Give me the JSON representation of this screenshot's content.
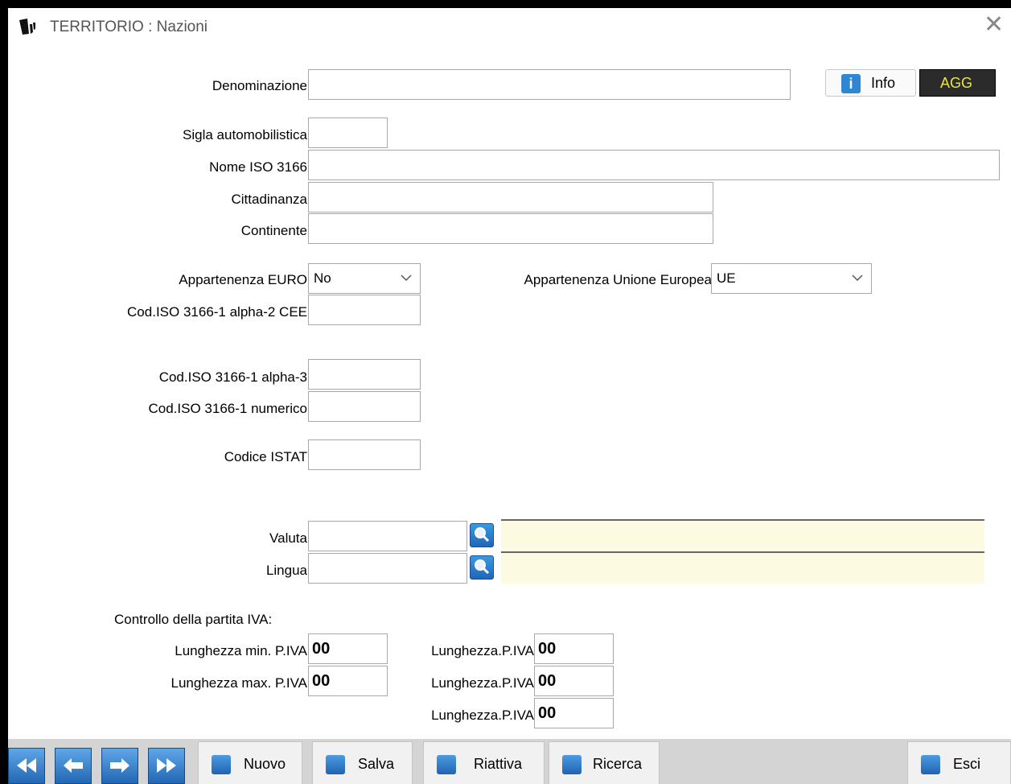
{
  "window": {
    "title": "TERRITORIO : Nazioni"
  },
  "header_buttons": {
    "info_label": "Info",
    "agg_label": "AGG"
  },
  "fields": {
    "denominazione": {
      "label": "Denominazione",
      "value": ""
    },
    "sigla": {
      "label": "Sigla automobilistica",
      "value": ""
    },
    "nome_iso": {
      "label": "Nome ISO 3166",
      "value": ""
    },
    "cittadinanza": {
      "label": "Cittadinanza",
      "value": ""
    },
    "continente": {
      "label": "Continente",
      "value": ""
    },
    "euro": {
      "label": "Appartenenza EURO",
      "value": "No"
    },
    "ue": {
      "label": "Appartenenza Unione Europea",
      "value": "UE"
    },
    "alpha2": {
      "label": "Cod.ISO 3166-1 alpha-2 CEE",
      "value": ""
    },
    "alpha3": {
      "label": "Cod.ISO 3166-1 alpha-3",
      "value": ""
    },
    "numerico": {
      "label": "Cod.ISO 3166-1 numerico",
      "value": ""
    },
    "istat": {
      "label": "Codice ISTAT",
      "value": ""
    },
    "valuta": {
      "label": "Valuta",
      "value": "",
      "desc": ""
    },
    "lingua": {
      "label": "Lingua",
      "value": "",
      "desc": ""
    }
  },
  "piva": {
    "section_label": "Controllo della partita IVA:",
    "min": {
      "label": "Lunghezza min. P.IVA",
      "value": "00"
    },
    "max": {
      "label": "Lunghezza max. P.IVA",
      "value": "00"
    },
    "len1": {
      "label": "Lunghezza.P.IVA",
      "value": "00"
    },
    "len2": {
      "label": "Lunghezza.P.IVA",
      "value": "00"
    },
    "len3": {
      "label": "Lunghezza.P.IVA",
      "value": "00"
    }
  },
  "toolbar": {
    "nuovo": "Nuovo",
    "salva": "Salva",
    "riattiva": "Riattiva",
    "ricerca": "Ricerca",
    "esci": "Esci"
  },
  "icons": [
    "app-logo-icon",
    "close-icon",
    "info-icon",
    "chevron-down-icon",
    "search-icon",
    "first-record-icon",
    "previous-record-icon",
    "next-record-icon",
    "last-record-icon",
    "new-icon",
    "save-icon",
    "restore-icon",
    "exit-icon"
  ]
}
